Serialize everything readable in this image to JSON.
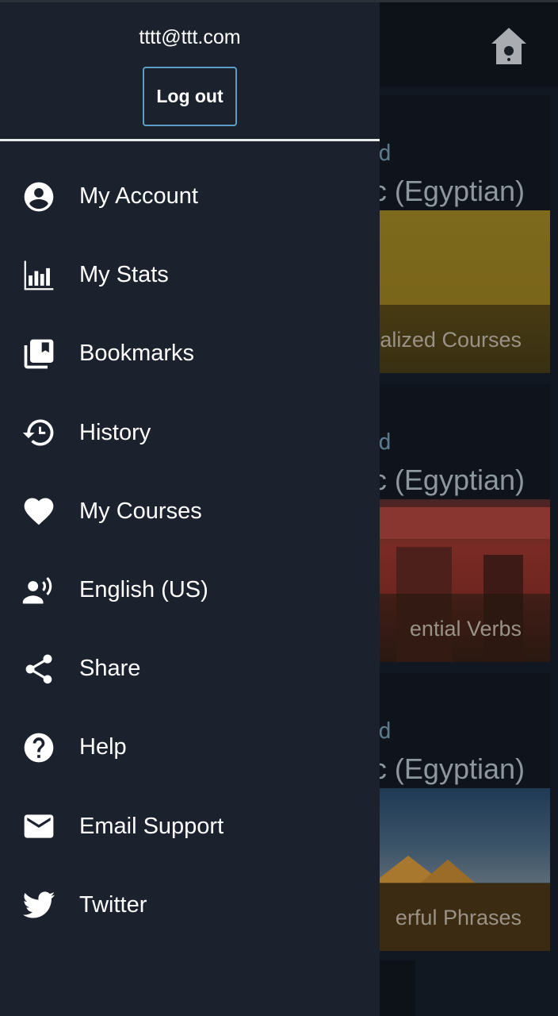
{
  "background": {
    "home_icon": "birdhouse-home-icon",
    "cards": [
      {
        "eyebrow": "d",
        "course_title": "c (Egyptian)",
        "caption": "alized Courses"
      },
      {
        "eyebrow": "d",
        "course_title": "c (Egyptian)",
        "caption": "ential Verbs"
      },
      {
        "eyebrow": "d",
        "course_title": "c (Egyptian)",
        "caption": "erful Phrases"
      }
    ]
  },
  "drawer": {
    "user_email": "tttt@ttt.com",
    "logout_label": "Log out",
    "accent_color": "#5b9fc4",
    "items": [
      {
        "label": "My Account",
        "icon": "account-circle-icon"
      },
      {
        "label": "My Stats",
        "icon": "bar-chart-icon"
      },
      {
        "label": "Bookmarks",
        "icon": "bookmarks-icon"
      },
      {
        "label": "History",
        "icon": "history-icon"
      },
      {
        "label": "My Courses",
        "icon": "heart-icon"
      },
      {
        "label": "English (US)",
        "icon": "voice-language-icon"
      },
      {
        "label": "Share",
        "icon": "share-icon"
      },
      {
        "label": "Help",
        "icon": "help-circle-icon"
      },
      {
        "label": "Email Support",
        "icon": "email-icon"
      },
      {
        "label": "Twitter",
        "icon": "twitter-icon"
      }
    ]
  }
}
